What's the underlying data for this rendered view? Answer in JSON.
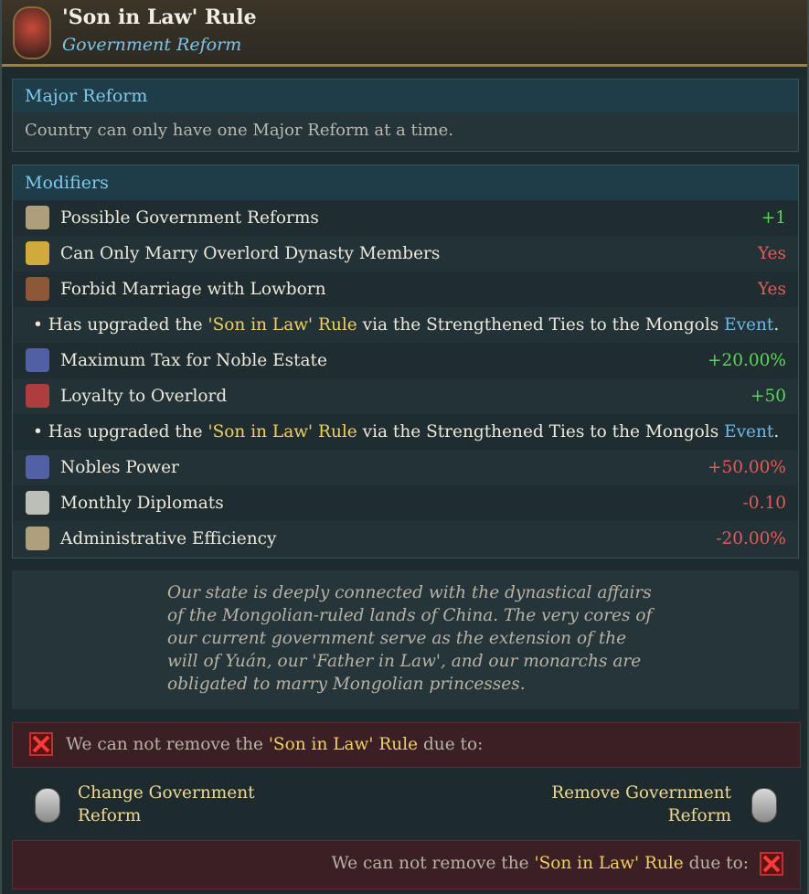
{
  "header": {
    "title": "'Son in Law' Rule",
    "subtitle": "Government Reform"
  },
  "major": {
    "heading": "Major Reform",
    "desc": "Country can only have one Major Reform at a time."
  },
  "modifiers": {
    "heading": "Modifiers",
    "rows": [
      {
        "label": "Possible Government Reforms",
        "value": "+1",
        "icon": "scroll-arrow-icon"
      },
      {
        "label": "Can Only Marry Overlord Dynasty Members",
        "value": "Yes",
        "icon": "star-icon"
      },
      {
        "label": "Forbid Marriage with Lowborn",
        "value": "Yes",
        "icon": "shield-icon"
      },
      {
        "note_pre": "Has upgraded the ",
        "note_hl": "'Son in Law' Rule",
        "note_mid": " via the Strengthened Ties to the Mongols ",
        "note_ev": "Event",
        "note_end": "."
      },
      {
        "label": "Maximum Tax for Noble Estate",
        "value": "+20.00%",
        "icon": "noble-tax-icon"
      },
      {
        "label": "Loyalty to Overlord",
        "value": "+50",
        "icon": "loyalty-icon"
      },
      {
        "note_pre": "Has upgraded the ",
        "note_hl": "'Son in Law' Rule",
        "note_mid": " via the Strengthened Ties to the Mongols ",
        "note_ev": "Event",
        "note_end": "."
      },
      {
        "label": "Nobles Power",
        "value": "+50.00%",
        "icon": "noble-power-icon"
      },
      {
        "label": "Monthly Diplomats",
        "value": "-0.10",
        "icon": "dove-icon"
      },
      {
        "label": "Administrative Efficiency",
        "value": "-20.00%",
        "icon": "scroll-check-icon"
      }
    ]
  },
  "flavor": "Our state is deeply connected with the dynastical affairs of the Mongolian-ruled lands of China. The very cores of our current government serve as the extension of the will of Yuán, our 'Father in Law', and our monarchs are obligated to marry Mongolian princesses.",
  "warn_top": {
    "pre": "We can not remove the ",
    "hl": "'Son in Law' Rule",
    "post": " due to:"
  },
  "buttons": {
    "change_1": "Change Government",
    "change_2": "Reform",
    "remove_1": "Remove Government",
    "remove_2": "Reform"
  },
  "warn_bottom": {
    "pre": "We can not remove the ",
    "hl": "'Son in Law' Rule",
    "post": " due to:"
  },
  "colors": {
    "positive": "#5cd45c",
    "negative": "#e45a5a",
    "gold": "#f0d060",
    "blue": "#7ec8ea"
  }
}
